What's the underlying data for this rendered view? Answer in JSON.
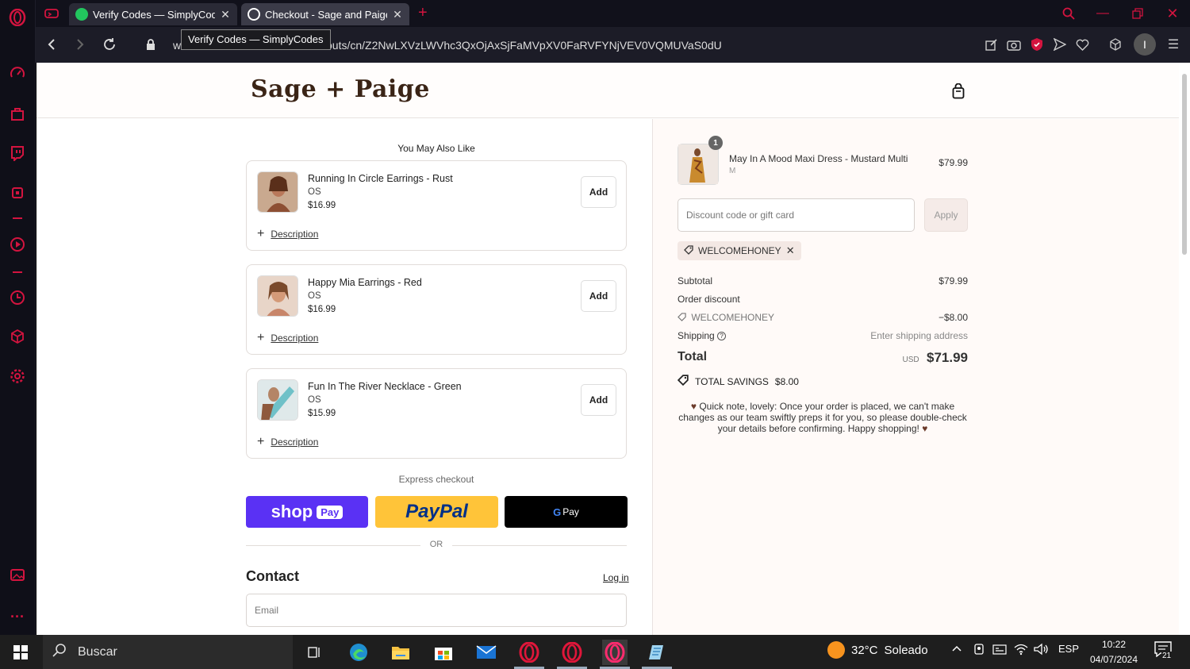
{
  "browser": {
    "tabs": [
      {
        "title": "Verify Codes — SimplyCodes"
      },
      {
        "title": "Checkout - Sage and Paige"
      }
    ],
    "tooltip": "Verify Codes — SimplyCodes",
    "url_visible_start": "w",
    "url_visible_end": "outs/cn/Z2NwLXVzLWVhc3QxOjAxSjFaMVpXV0FaRVFYNjVEV0VQMUVaS0dU"
  },
  "store": {
    "logo_text": "Sage + Paige"
  },
  "upsell": {
    "title": "You May Also Like",
    "items": [
      {
        "name": "Running In Circle Earrings - Rust",
        "variant": "OS",
        "price": "$16.99",
        "add": "Add",
        "desc": "Description"
      },
      {
        "name": "Happy Mia Earrings - Red",
        "variant": "OS",
        "price": "$16.99",
        "add": "Add",
        "desc": "Description"
      },
      {
        "name": "Fun In The River Necklace - Green",
        "variant": "OS",
        "price": "$15.99",
        "add": "Add",
        "desc": "Description"
      }
    ]
  },
  "express": {
    "label": "Express checkout",
    "shop": "shop",
    "shop_pay": "Pay",
    "paypal": "PayPal",
    "gpay": "Pay",
    "or": "OR"
  },
  "contact": {
    "title": "Contact",
    "login": "Log in",
    "email_placeholder": "Email"
  },
  "summary": {
    "item": {
      "qty": "1",
      "name": "May In A Mood Maxi Dress - Mustard Multi",
      "variant": "M",
      "price": "$79.99"
    },
    "discount_placeholder": "Discount code or gift card",
    "apply": "Apply",
    "applied_code": "WELCOMEHONEY",
    "subtotal_label": "Subtotal",
    "subtotal": "$79.99",
    "order_discount_label": "Order discount",
    "discount_code": "WELCOMEHONEY",
    "discount_amount": "−$8.00",
    "shipping_label": "Shipping",
    "shipping_value": "Enter shipping address",
    "total_label": "Total",
    "currency": "USD",
    "total": "$71.99",
    "savings_label": "TOTAL SAVINGS",
    "savings": "$8.00",
    "note": "Quick note, lovely: Once your order is placed, we can't make changes as our team swiftly preps it for you, so please double-check your details before confirming. Happy shopping!"
  },
  "taskbar": {
    "search": "Buscar",
    "temp": "32°C",
    "weather": "Soleado",
    "lang": "ESP",
    "time": "10:22",
    "date": "04/07/2024",
    "notif_count": "21"
  },
  "colors": {
    "opera_red": "#d3143f",
    "shop_pay": "#5a31f4",
    "paypal": "#ffc439",
    "paypal_blue": "#003087"
  }
}
